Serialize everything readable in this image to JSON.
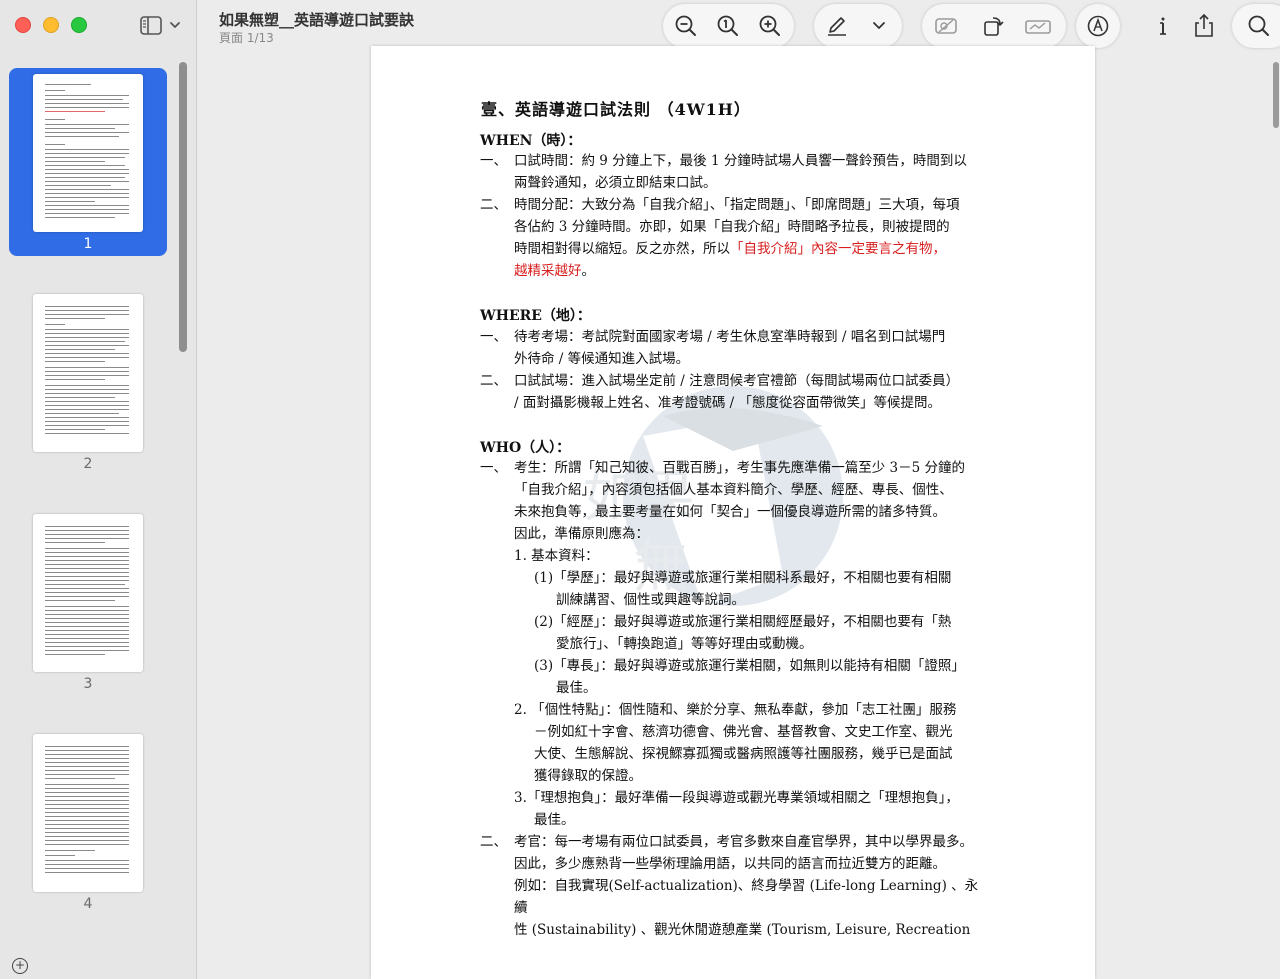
{
  "window": {
    "title": "如果無塑__英語導遊口試要訣",
    "page_indicator": "頁面 1/13"
  },
  "sidebar": {
    "thumbnails": [
      {
        "label": "1",
        "selected": true
      },
      {
        "label": "2",
        "selected": false
      },
      {
        "label": "3",
        "selected": false
      },
      {
        "label": "4",
        "selected": false
      }
    ]
  },
  "toolbar": {
    "icons": [
      "zoom-out-icon",
      "actual-size-icon",
      "zoom-in-icon",
      "markup-pen-icon",
      "chevron-down-icon",
      "rotate-icon",
      "crop-icon",
      "redact-icon",
      "highlight-icon",
      "info-icon",
      "share-icon",
      "search-icon"
    ]
  },
  "document": {
    "heading": "壹、英語導遊口試法則 （4W1H）",
    "when_title": "WHEN（時）：",
    "when_1_num": "一、",
    "when_1": "口試時間：約 9 分鐘上下，最後 1 分鐘時試場人員響一聲鈴預告，時間到以",
    "when_1b": "兩聲鈴通知，必須立即結束口試。",
    "when_2_num": "二、",
    "when_2": "時間分配：大致分為「自我介紹」、「指定問題」、「即席問題」三大項，每項",
    "when_2b": "各佔約 3 分鐘時間。亦即，如果「自我介紹」時間略予拉長，則被提問的",
    "when_2c_plain": "時間相對得以縮短。反之亦然，所以",
    "when_2c_red": "「自我介紹」內容一定要言之有物，",
    "when_2d_red": "越精采越好",
    "when_2d_end": "。",
    "where_title": "WHERE（地）：",
    "where_1_num": "一、",
    "where_1": "待考考場：考試院對面國家考場 / 考生休息室準時報到 / 唱名到口試場門",
    "where_1b": "外待命 / 等候通知進入試場。",
    "where_2_num": "二、",
    "where_2": "口試試場：進入試場坐定前 / 注意問候考官禮節（每間試場兩位口試委員）",
    "where_2b": "/ 面對攝影機報上姓名、准考證號碼 / 「態度從容面帶微笑」等候提問。",
    "who_title": "WHO（人）：",
    "who_1_num": "一、",
    "who_1": "考生：所謂「知己知彼、百戰百勝」，考生事先應準備一篇至少 3－5 分鐘的",
    "who_1b": "「自我介紹」，內容須包括個人基本資料簡介、學歷、經歷、專長、個性、",
    "who_1c": "未來抱負等，最主要考量在如何「契合」一個優良導遊所需的諸多特質。",
    "who_1d": "因此，準備原則應為：",
    "basic": "1. 基本資料：",
    "b1": "(1)「學歷」：最好與導遊或旅運行業相關科系最好，不相關也要有相關",
    "b1b": "訓練講習、個性或興趣等說詞。",
    "b2": "(2)「經歷」：最好與導遊或旅運行業相關經歷最好，不相關也要有「熱",
    "b2b": "愛旅行」、「轉換跑道」等等好理由或動機。",
    "b3": "(3)「專長」：最好與導遊或旅運行業相關，如無則以能持有相關「證照」",
    "b3b": "最佳。",
    "p2": "2. 「個性特點」：個性隨和、樂於分享、無私奉獻，參加「志工社團」服務",
    "p2b": "－例如紅十字會、慈濟功德會、佛光會、基督教會、文史工作室、觀光",
    "p2c": "大使、生態解說、探視鰥寡孤獨或醫病照護等社團服務，幾乎已是面試",
    "p2d": "獲得錄取的保證。",
    "p3": "3.「理想抱負」：最好準備一段與導遊或觀光專業領域相關之「理想抱負」，",
    "p3b": "最佳。",
    "who_2_num": "二、",
    "who_2": "考官：每一考場有兩位口試委員，考官多數來自產官學界，其中以學界最多。",
    "who_2b": "因此，多少應熟背一些學術理論用語，以共同的語言而拉近雙方的距離。",
    "who_2c": "例如：自我實現(Self-actualization)、終身學習 (Life-long Learning) 、永續",
    "who_2d": "性 (Sustainability) 、觀光休閒遊憩產業 (Tourism, Leisure, Recreation"
  }
}
